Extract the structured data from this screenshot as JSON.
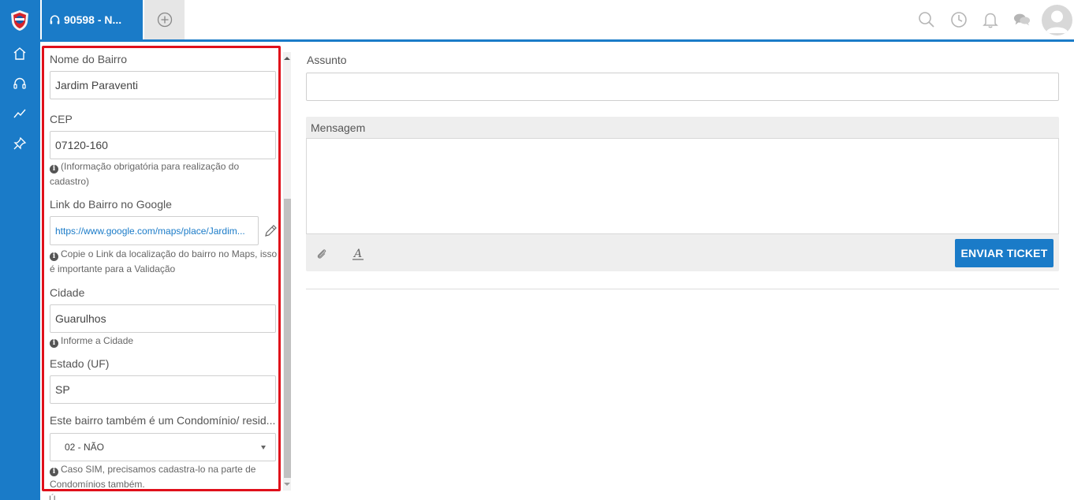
{
  "colors": {
    "brand_blue": "#1a7bc8",
    "highlight_red": "#e0101b",
    "panel_gray": "#eeeeee"
  },
  "sidebar": {
    "icons": [
      "shield-logo-icon",
      "home-icon",
      "headset-icon",
      "trend-chart-icon",
      "pin-icon"
    ]
  },
  "tabs": {
    "active_label": "90598 - N...",
    "active_icon": "headset-icon",
    "add_icon": "plus-circle-icon"
  },
  "header_icons": [
    "search-icon",
    "clock-icon",
    "bell-icon",
    "chat-icon",
    "avatar"
  ],
  "form": {
    "bairro_label": "Nome do Bairro",
    "bairro_value": "Jardim Paraventi",
    "cep_label": "CEP",
    "cep_value": "07120-160",
    "cep_hint": "(Informação obrigatória para realização do cadastro)",
    "link_label": "Link do Bairro no Google",
    "link_value": "https://www.google.com/maps/place/Jardim...",
    "link_hint": "Copie o Link da localização do bairro no Maps, isso é importante para a Validação",
    "cidade_label": "Cidade",
    "cidade_value": "Guarulhos",
    "cidade_hint": "Informe a Cidade",
    "estado_label": "Estado (UF)",
    "estado_value": "SP",
    "condominio_label": "Este bairro também é um Condomínio/ resid...",
    "condominio_value": "02 - NÃO",
    "condominio_hint": "Caso SIM, precisamos cadastra-lo na parte de Condomínios também.",
    "bottom_cut_text": "Ú..."
  },
  "main": {
    "assunto_label": "Assunto",
    "assunto_value": "",
    "mensagem_label": "Mensagem",
    "mensagem_value": "",
    "send_label": "ENVIAR TICKET",
    "tools": [
      "paperclip-icon",
      "text-format-icon"
    ]
  }
}
